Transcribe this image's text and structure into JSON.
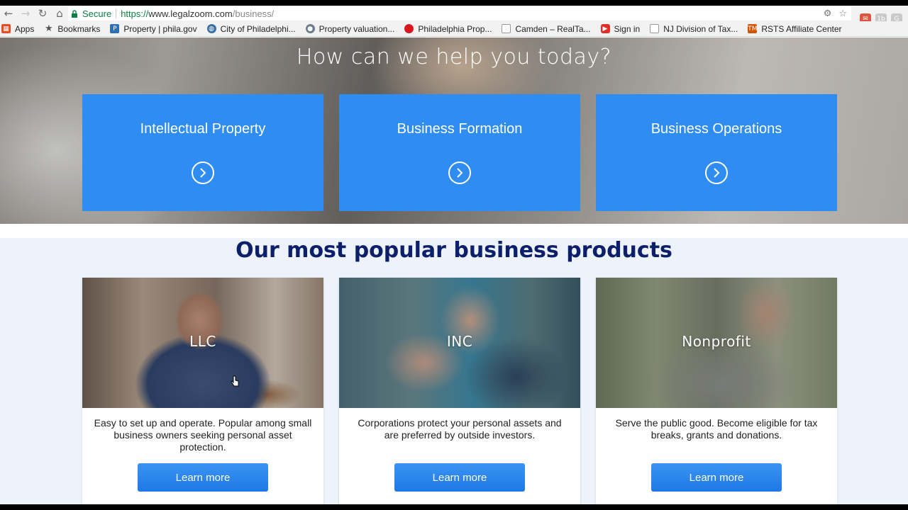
{
  "browser": {
    "secure_label": "Secure",
    "url_scheme": "https://",
    "url_host": "www.legalzoom.com",
    "url_path": "/business/",
    "icons": [
      "back-icon",
      "forward-icon",
      "reload-icon",
      "home-icon",
      "lock-icon",
      "translate-icon",
      "star-icon"
    ]
  },
  "bookmarks": [
    {
      "label": "Apps",
      "icon": "apps-grid-icon",
      "color": "#e44d26"
    },
    {
      "label": "Bookmarks",
      "icon": "star-icon",
      "color": "#555555"
    },
    {
      "label": "Property | phila.gov",
      "icon": "phila-icon",
      "color": "#2f6fb5"
    },
    {
      "label": "City of Philadelphi...",
      "icon": "globe-icon",
      "color": "#3a6fa1"
    },
    {
      "label": "Property valuation...",
      "icon": "seal-icon",
      "color": "#6b7d8c"
    },
    {
      "label": "Philadelphia Prop...",
      "icon": "red-dot-icon",
      "color": "#d9161f"
    },
    {
      "label": "Camden – RealTa...",
      "icon": "page-icon",
      "color": "#999999"
    },
    {
      "label": "Sign in",
      "icon": "youtube-icon",
      "color": "#e52d27"
    },
    {
      "label": "NJ Division of Tax...",
      "icon": "page-icon",
      "color": "#999999"
    },
    {
      "label": "RSTS Affiliate Center",
      "icon": "tm-icon",
      "color": "#d35400"
    }
  ],
  "hero": {
    "title": "How can we help you today?",
    "tiles": [
      {
        "label": "Intellectual Property"
      },
      {
        "label": "Business Formation"
      },
      {
        "label": "Business Operations"
      }
    ]
  },
  "products": {
    "title": "Our most popular business products",
    "cards": [
      {
        "label": "LLC",
        "description": "Easy to set up and operate. Popular among small business owners seeking personal asset protection.",
        "button": "Learn more"
      },
      {
        "label": "INC",
        "description": "Corporations protect your personal assets and are preferred by outside investors.",
        "button": "Learn more"
      },
      {
        "label": "Nonprofit",
        "description": "Serve the public good. Become eligible for tax breaks, grants and donations.",
        "button": "Learn more"
      }
    ]
  },
  "colors": {
    "tile_blue": "#2f8cf1",
    "heading_navy": "#0c1f6b",
    "button_blue": "#1f78e6",
    "secure_green": "#0b8043"
  }
}
